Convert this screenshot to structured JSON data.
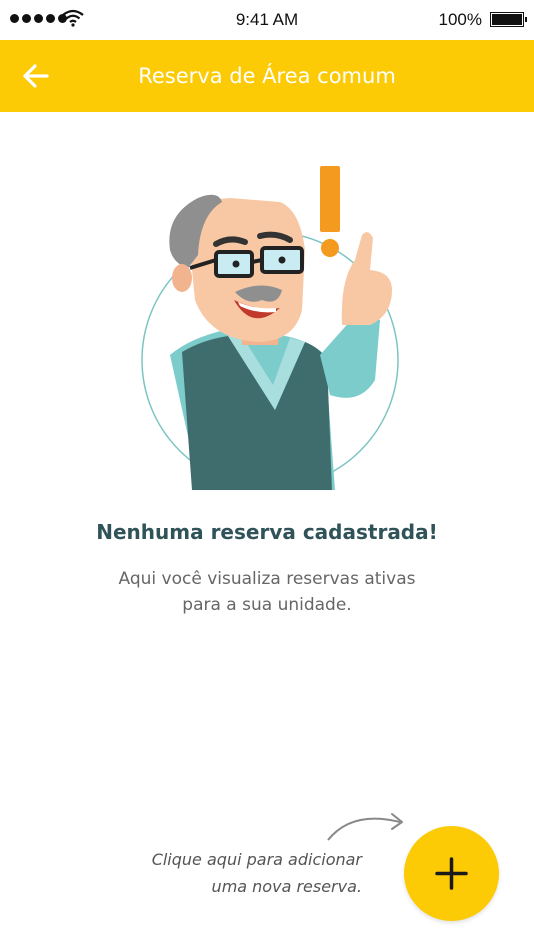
{
  "status_bar": {
    "time": "9:41 AM",
    "battery": "100%",
    "signal_icon": "signal-dots-icon",
    "wifi_icon": "wifi-icon",
    "battery_icon": "battery-icon"
  },
  "header": {
    "title": "Reserva de Área comum",
    "back_icon": "arrow-left-icon",
    "background_color": "#fccb05"
  },
  "empty_state": {
    "title": "Nenhuma reserva cadastrada!",
    "description_line1": "Aqui você visualiza reservas ativas",
    "description_line2": "para a sua unidade."
  },
  "add_hint": {
    "line1": "Clique aqui para adicionar",
    "line2": "uma nova reserva."
  },
  "fab": {
    "icon": "plus-icon",
    "color": "#fccb05"
  }
}
